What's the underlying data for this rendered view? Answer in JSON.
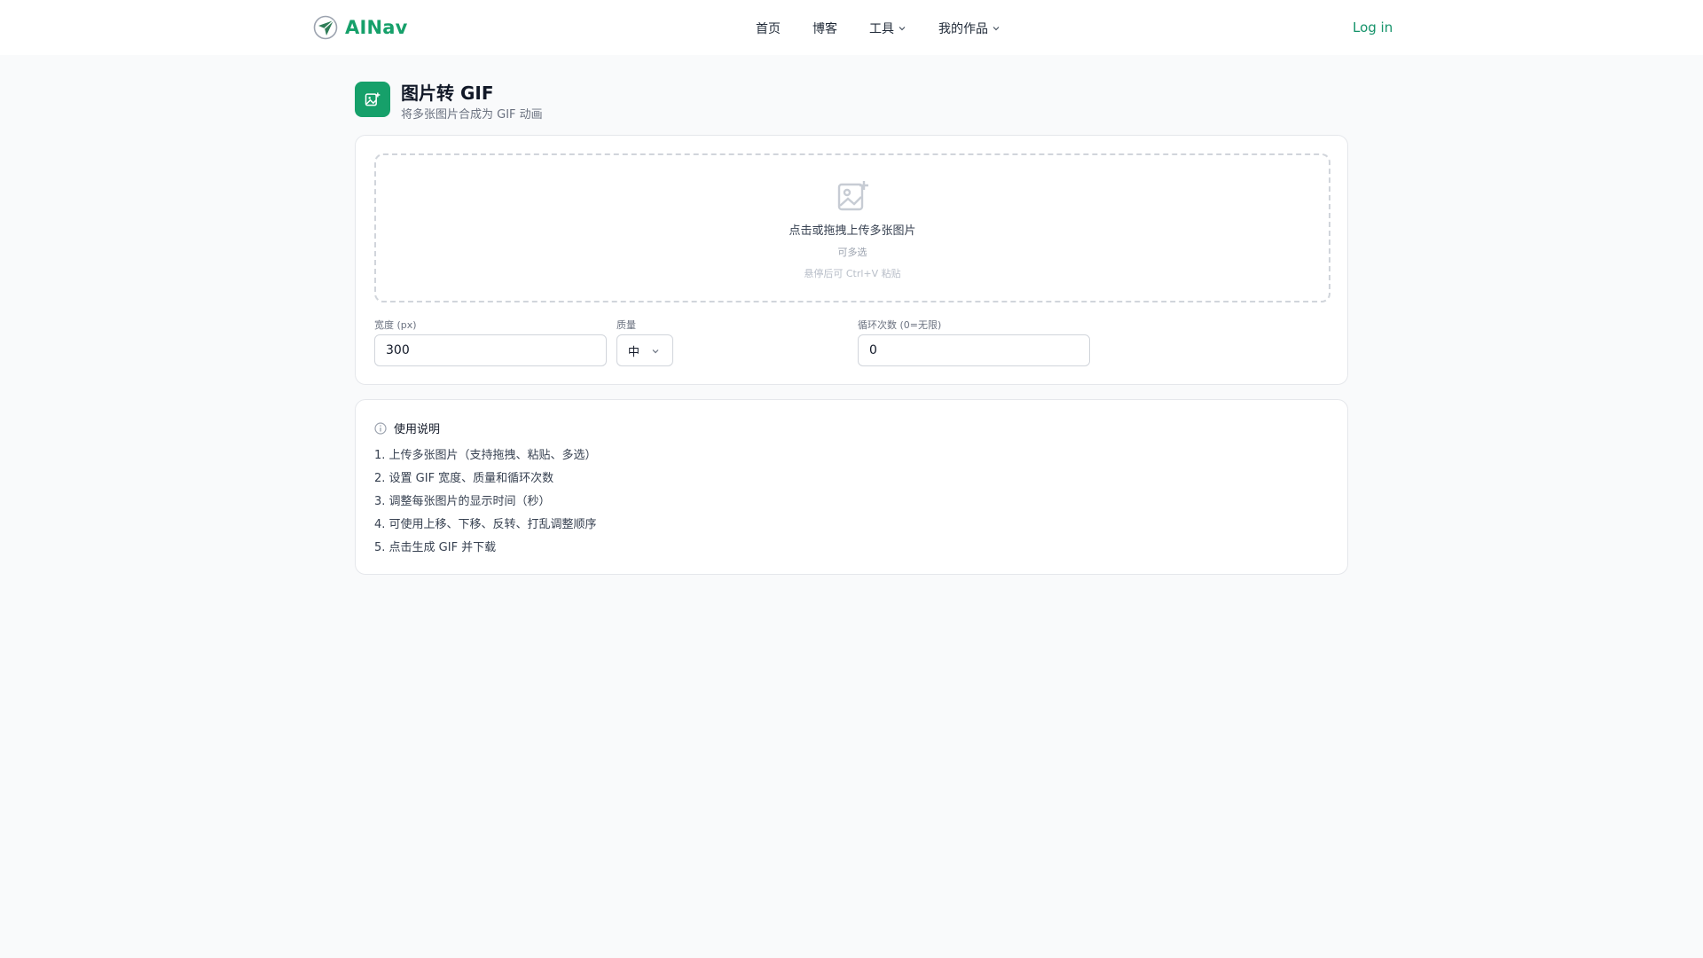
{
  "brand": {
    "name": "AINav",
    "accent": "#16a06a"
  },
  "nav": {
    "items": [
      {
        "label": "首页",
        "has_dropdown": false
      },
      {
        "label": "博客",
        "has_dropdown": false
      },
      {
        "label": "工具",
        "has_dropdown": true
      },
      {
        "label": "我的作品",
        "has_dropdown": true
      }
    ],
    "login_label": "Log in"
  },
  "page": {
    "icon": "image-plus-icon",
    "title": "图片转 GIF",
    "subtitle": "将多张图片合成为 GIF 动画"
  },
  "upload": {
    "icon": "image-plus-icon",
    "main_text": "点击或拖拽上传多张图片",
    "sub_text": "可多选",
    "hint_text": "悬停后可 Ctrl+V 粘贴"
  },
  "settings": {
    "width": {
      "label": "宽度 (px)",
      "value": "300"
    },
    "quality": {
      "label": "质量",
      "value": "中"
    },
    "loop": {
      "label": "循环次数 (0=无限)",
      "value": "0"
    }
  },
  "help": {
    "icon": "info-icon",
    "title": "使用说明",
    "steps": [
      "1. 上传多张图片（支持拖拽、粘贴、多选）",
      "2. 设置 GIF 宽度、质量和循环次数",
      "3. 调整每张图片的显示时间（秒）",
      "4. 可使用上移、下移、反转、打乱调整顺序",
      "5. 点击生成 GIF 并下载"
    ]
  }
}
